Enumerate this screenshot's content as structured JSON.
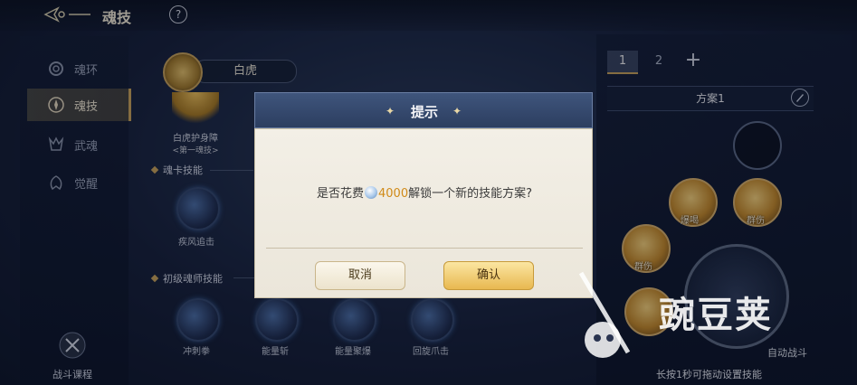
{
  "header": {
    "title": "魂技",
    "help_icon": "question-icon",
    "back_icon": "back-ornament-icon"
  },
  "sidebar": {
    "items": [
      {
        "label": "魂环",
        "icon": "ring-icon",
        "active": false
      },
      {
        "label": "魂技",
        "icon": "skill-icon",
        "active": true
      },
      {
        "label": "武魂",
        "icon": "spirit-icon",
        "active": false
      },
      {
        "label": "觉醒",
        "icon": "awaken-icon",
        "active": false
      }
    ],
    "course_label": "战斗课程"
  },
  "spirit": {
    "name": "白虎"
  },
  "skills": {
    "top_skill": {
      "name": "白虎护身障",
      "tag": "<第一魂技>"
    },
    "card_section": "魂卡技能",
    "card_skill": "疾风追击",
    "basic_section": "初级魂师技能",
    "basic_skills": [
      "冲刺拳",
      "能量斩",
      "能量聚爆",
      "回旋爪击"
    ]
  },
  "right_panel": {
    "tabs": [
      "1",
      "2"
    ],
    "active_tab": "1",
    "add_icon": "plus-icon",
    "scheme_label": "方案1",
    "slot_tags": [
      "爆喝",
      "群伤",
      "群伤"
    ],
    "auto_battle": "自动战斗",
    "hint": "长按1秒可拖动设置技能"
  },
  "dialog": {
    "title": "提示",
    "message_pre": "是否花费",
    "cost": "4000",
    "message_post": "解锁一个新的技能方案?",
    "cancel": "取消",
    "confirm": "确认"
  },
  "watermark": {
    "text": "豌豆荚"
  },
  "colors": {
    "accent_gold": "#c9a45a",
    "cost_orange": "#d08a18",
    "panel_dark": "#16203a"
  }
}
